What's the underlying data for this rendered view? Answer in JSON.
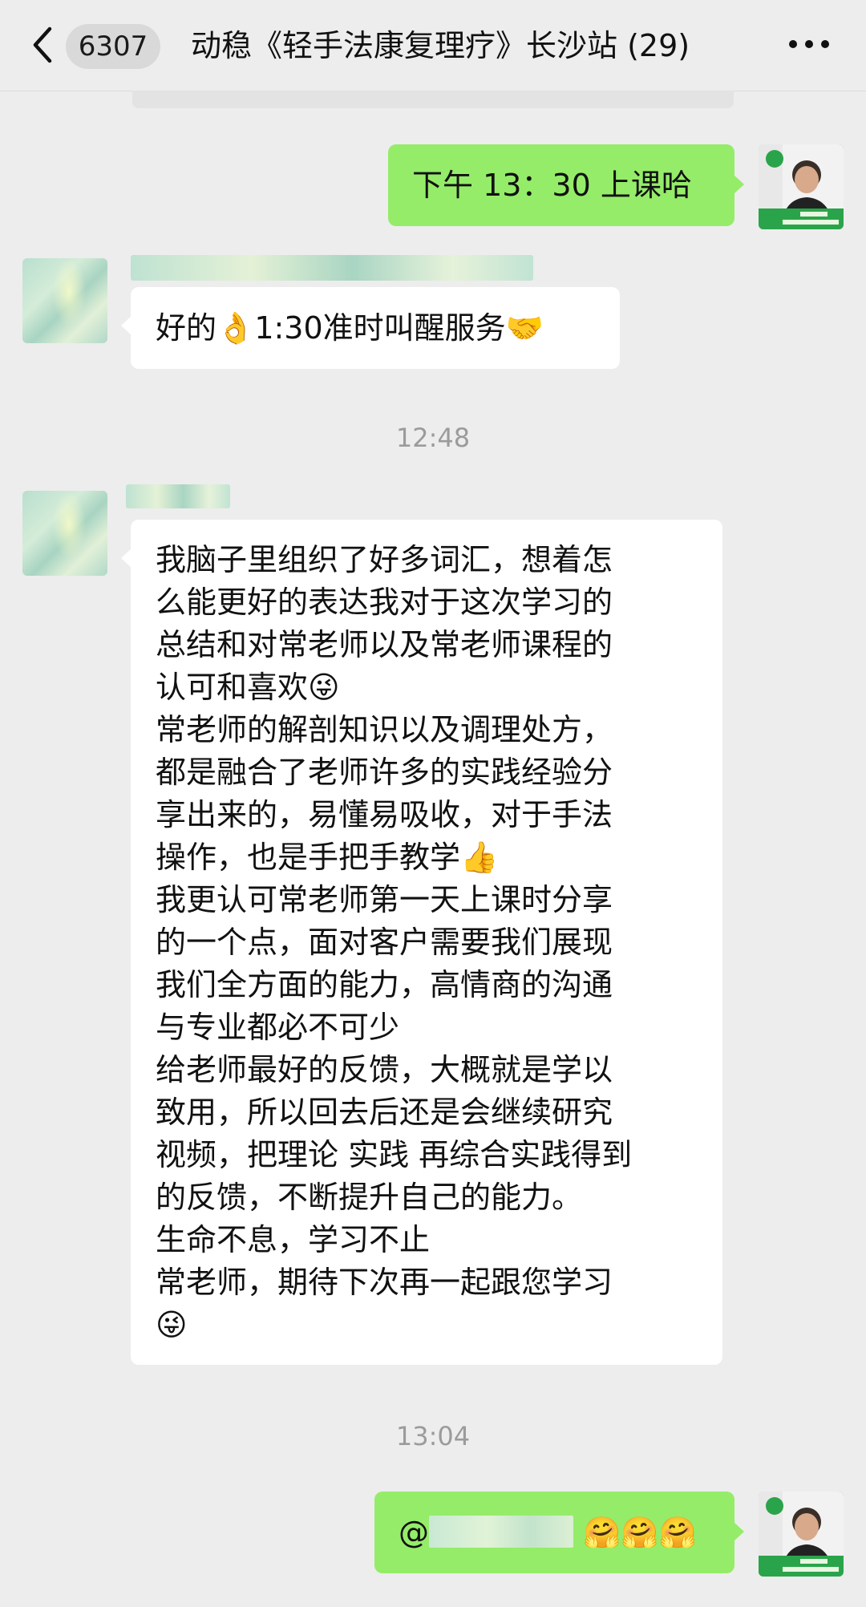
{
  "header": {
    "back_icon": "chevron-left-icon",
    "unread_count": "6307",
    "title": "动稳《轻手法康复理疗》长沙站 (29)",
    "more_icon": "ellipsis-icon"
  },
  "colors": {
    "background": "#ededed",
    "bubble_self": "#95ec69",
    "bubble_other": "#ffffff",
    "timestamp": "#9b9b9b"
  },
  "messages": {
    "m1": {
      "sender": "self",
      "text": "下午 13：30 上课哈"
    },
    "m2": {
      "sender": "other",
      "text": "好的👌1:30准时叫醒服务🤝"
    },
    "time1": "12:48",
    "m3": {
      "sender": "other",
      "lines": [
        "我脑子里组织了好多词汇，想着怎",
        "么能更好的表达我对于这次学习的",
        "总结和对常老师以及常老师课程的",
        "认可和喜欢😜",
        "常老师的解剖知识以及调理处方，",
        "都是融合了老师许多的实践经验分",
        "享出来的，易懂易吸收，对于手法",
        "操作，也是手把手教学👍",
        "我更认可常老师第一天上课时分享",
        "的一个点，面对客户需要我们展现",
        "我们全方面的能力，高情商的沟通",
        "与专业都必不可少",
        "给老师最好的反馈，大概就是学以",
        "致用，所以回去后还是会继续研究",
        "视频，把理论 实践 再综合实践得到",
        "的反馈，不断提升自己的能力。",
        "生命不息，学习不止",
        "常老师，期待下次再一起跟您学习",
        "😜"
      ]
    },
    "time2": "13:04",
    "m4": {
      "sender": "self",
      "prefix": "@",
      "emojis": "🤗🤗🤗"
    }
  }
}
